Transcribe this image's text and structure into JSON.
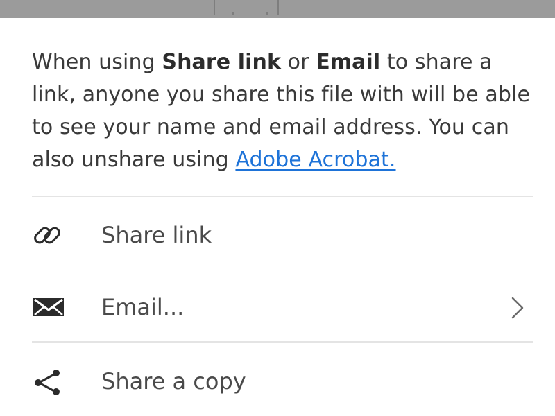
{
  "share_sheet": {
    "info": {
      "part1": "When using ",
      "bold1": "Share link",
      "part2": " or ",
      "bold2": "Email",
      "part3": " to share a link, anyone you share this file with will be able to see your name and email address. You can also unshare using ",
      "link_text": "Adobe Acrobat."
    },
    "items": [
      {
        "label": "Share link",
        "icon": "link-icon"
      },
      {
        "label": "Email...",
        "icon": "envelope-icon",
        "trailing_icon": "chevron-right-icon"
      },
      {
        "label": "Share a copy",
        "icon": "share-icon"
      }
    ]
  },
  "colors": {
    "link": "#1e73d8",
    "text": "#3a3a3a",
    "icon": "#2b2b2b",
    "divider": "#e4e4e4",
    "backdrop": "#9b9b9b"
  }
}
